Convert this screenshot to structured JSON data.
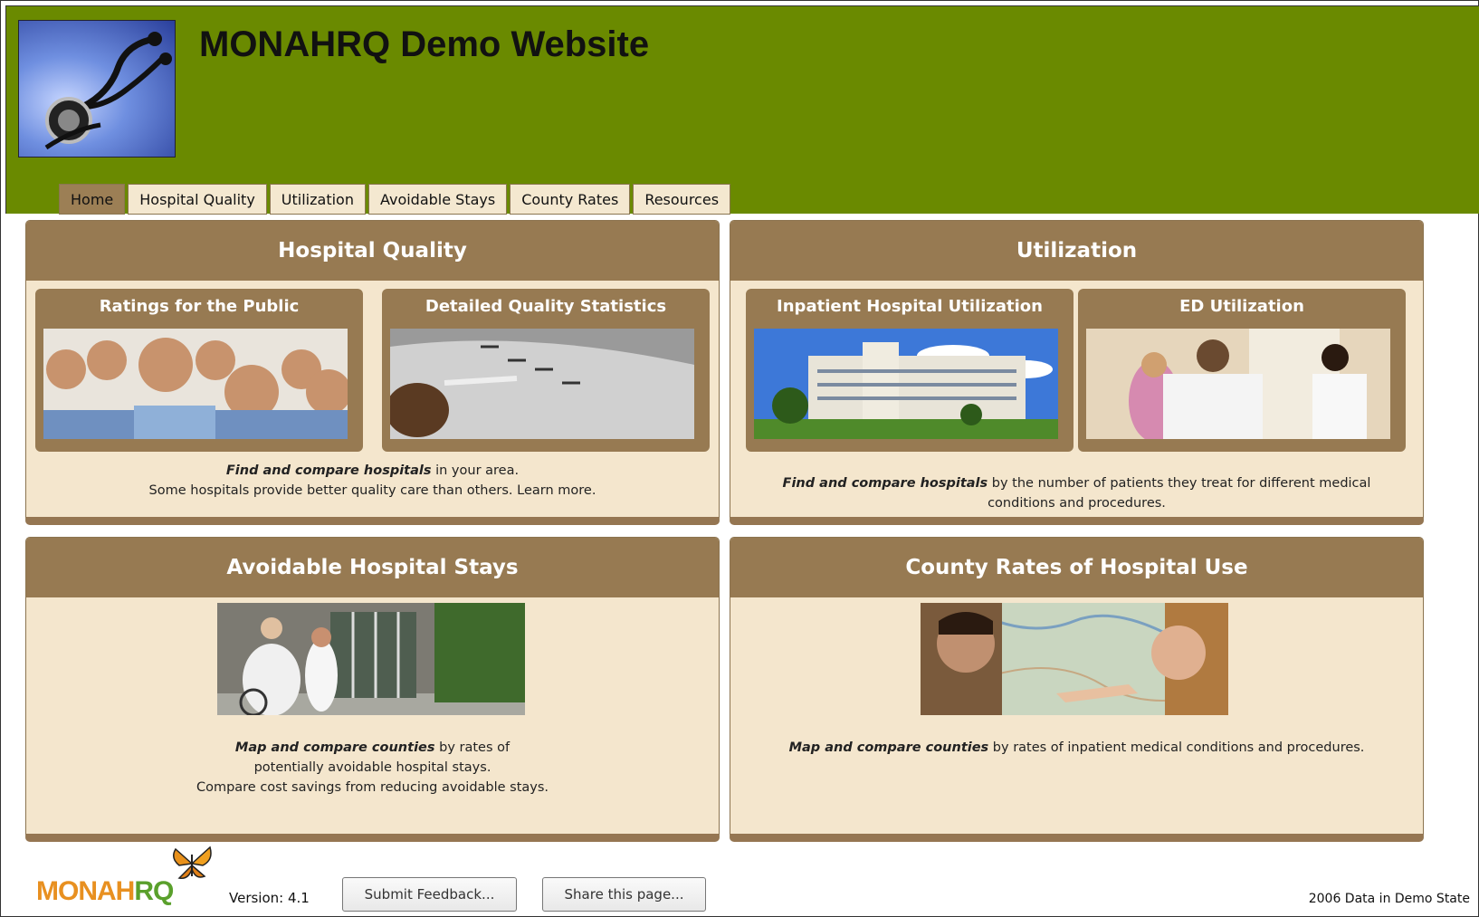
{
  "site": {
    "title": "MONAHRQ Demo Website"
  },
  "nav": {
    "items": [
      {
        "label": "Home"
      },
      {
        "label": "Hospital Quality"
      },
      {
        "label": "Utilization"
      },
      {
        "label": "Avoidable Stays"
      },
      {
        "label": "County Rates"
      },
      {
        "label": "Resources"
      }
    ],
    "active": "Home"
  },
  "panels": {
    "hospital_quality": {
      "title": "Hospital Quality",
      "cards": [
        {
          "title": "Ratings for the Public"
        },
        {
          "title": "Detailed Quality Statistics"
        }
      ],
      "desc_em": "Find and compare hospitals",
      "desc_line1": " in your area.",
      "desc_line2": "Some hospitals provide better quality care than others.  Learn more."
    },
    "utilization": {
      "title": "Utilization",
      "cards": [
        {
          "title": "Inpatient Hospital Utilization"
        },
        {
          "title": "ED Utilization"
        }
      ],
      "desc_em": "Find and compare hospitals",
      "desc_line1": " by the number of patients they treat for different medical",
      "desc_line2": "conditions and procedures."
    },
    "avoidable": {
      "title": "Avoidable Hospital Stays",
      "desc_em": "Map and compare counties",
      "desc_line1": " by rates of",
      "desc_line2": "potentially avoidable hospital stays.",
      "desc_line3": "Compare cost savings from reducing avoidable stays."
    },
    "county": {
      "title": "County Rates of Hospital Use",
      "desc_em": "Map and compare counties",
      "desc_line1": " by rates of inpatient medical conditions and procedures."
    }
  },
  "footer": {
    "logo_a": "MONAH",
    "logo_b": "RQ",
    "version": "Version: 4.1",
    "feedback_label": "Submit Feedback...",
    "share_label": "Share this page...",
    "note": "2006 Data in Demo State"
  },
  "colors": {
    "header_green": "#6a8a00",
    "panel_brown": "#977a52",
    "panel_bg": "#f4e6cd"
  }
}
